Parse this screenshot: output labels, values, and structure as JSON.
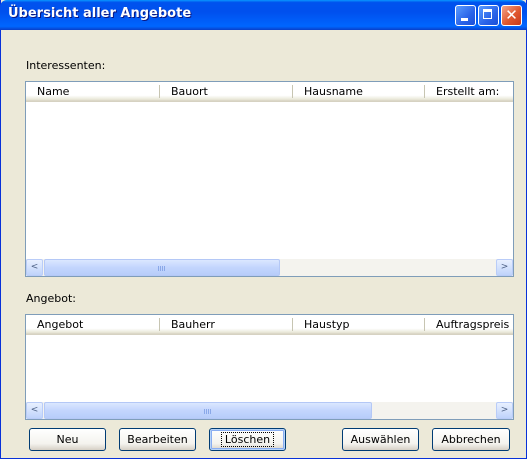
{
  "window": {
    "title": "Übersicht aller Angebote"
  },
  "interessenten": {
    "label": "Interessenten:",
    "columns": [
      "Name",
      "Bauort",
      "Hausname",
      "Erstellt am:"
    ]
  },
  "angebot": {
    "label": "Angebot:",
    "columns": [
      "Angebot",
      "Bauherr",
      "Haustyp",
      "Auftragspreis"
    ]
  },
  "scroll": {
    "left_arrow": "<",
    "right_arrow": ">"
  },
  "buttons": {
    "neu": "Neu",
    "bearbeiten": "Bearbeiten",
    "loeschen": "Löschen",
    "auswaehlen": "Auswählen",
    "abbrechen": "Abbrechen"
  }
}
